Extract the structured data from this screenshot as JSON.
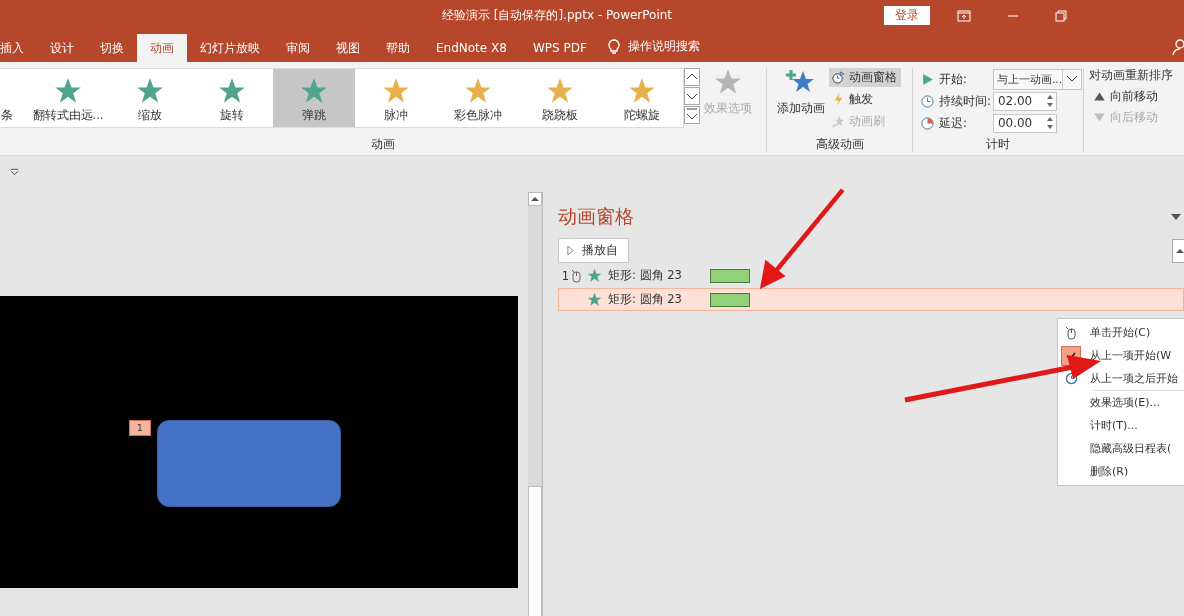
{
  "window": {
    "title": "经验演示 [自动保存的].pptx  -  PowerPoint",
    "login": "登录"
  },
  "tabs": [
    {
      "label": "插入",
      "selected": false
    },
    {
      "label": "设计",
      "selected": false
    },
    {
      "label": "切换",
      "selected": false
    },
    {
      "label": "动画",
      "selected": true
    },
    {
      "label": "幻灯片放映",
      "selected": false
    },
    {
      "label": "审阅",
      "selected": false
    },
    {
      "label": "视图",
      "selected": false
    },
    {
      "label": "帮助",
      "selected": false
    },
    {
      "label": "EndNote X8",
      "selected": false
    },
    {
      "label": "WPS PDF",
      "selected": false
    }
  ],
  "tell_me": "操作说明搜索",
  "animation_gallery": {
    "label": "动画",
    "items": [
      {
        "label": "条",
        "kind": "partial",
        "selected": false
      },
      {
        "label": "翻转式由远...",
        "kind": "entrance",
        "selected": false
      },
      {
        "label": "缩放",
        "kind": "entrance",
        "selected": false
      },
      {
        "label": "旋转",
        "kind": "entrance",
        "selected": false
      },
      {
        "label": "弹跳",
        "kind": "entrance",
        "selected": true
      },
      {
        "label": "脉冲",
        "kind": "emphasis",
        "selected": false
      },
      {
        "label": "彩色脉冲",
        "kind": "emphasis",
        "selected": false
      },
      {
        "label": "跷跷板",
        "kind": "emphasis",
        "selected": false
      },
      {
        "label": "陀螺旋",
        "kind": "emphasis",
        "selected": false
      }
    ],
    "effect_options": {
      "label": "效果选项",
      "disabled": true
    }
  },
  "advanced": {
    "label": "高级动画",
    "add": "添加动画",
    "pane": {
      "label": "动画窗格",
      "selected": true
    },
    "trigger": "触发",
    "painter": {
      "label": "动画刷",
      "disabled": true
    }
  },
  "timing": {
    "label": "计时",
    "start_label": "开始:",
    "start_value": "与上一动画...",
    "duration_label": "持续时间:",
    "duration_value": "02.00",
    "delay_label": "延迟:",
    "delay_value": "00.00"
  },
  "reorder": {
    "label": "对动画重新排序",
    "earlier": {
      "label": "向前移动",
      "disabled": false
    },
    "later": {
      "label": "向后移动",
      "disabled": true
    }
  },
  "slide": {
    "shape_tag": "1"
  },
  "animation_pane": {
    "title": "动画窗格",
    "play_from": "播放自",
    "rows": [
      {
        "number": "1",
        "on_click": true,
        "name": "矩形: 圆角 23",
        "selected": false
      },
      {
        "number": "",
        "on_click": false,
        "name": "矩形: 圆角 23",
        "selected": true
      }
    ]
  },
  "context_menu": [
    {
      "label": "单击开始(C)",
      "kind": "start-option",
      "checked": false
    },
    {
      "label": "从上一项开始(W",
      "kind": "start-option",
      "checked": true
    },
    {
      "label": "从上一项之后开始",
      "kind": "start-option",
      "checked": false
    },
    {
      "label": "效果选项(E)...",
      "kind": "command",
      "checked": false
    },
    {
      "label": "计时(T)...",
      "kind": "command",
      "checked": false
    },
    {
      "label": "隐藏高级日程表(",
      "kind": "command",
      "checked": false
    },
    {
      "label": "删除(R)",
      "kind": "command",
      "checked": false
    }
  ]
}
